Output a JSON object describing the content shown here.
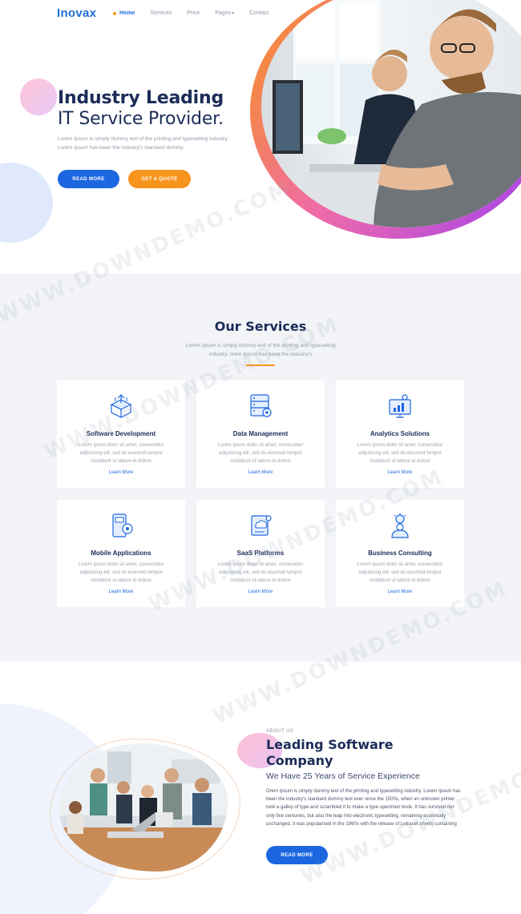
{
  "nav": {
    "logo": "Inovax",
    "items": [
      {
        "label": "Home",
        "active": true
      },
      {
        "label": "Services",
        "active": false
      },
      {
        "label": "Price",
        "active": false
      },
      {
        "label": "Pages",
        "active": false,
        "dropdown": true
      },
      {
        "label": "Contact",
        "active": false
      }
    ]
  },
  "hero": {
    "title_line1": "Industry Leading",
    "title_line2": "IT Service Provider.",
    "description_line1": "Lorem Ipsum is simply dummy text of the printing and typesetting industry.",
    "description_line2": "Lorem Ipsum has been the industry's standard dummy.",
    "btn_read_more": "READ MORE",
    "btn_quote": "GET A QUOTE"
  },
  "services": {
    "title": "Our Services",
    "description_line1": "Lorem Ipsum is simply dummy text of the printing and typesetting",
    "description_line2": "industry. orem Ipsum has been the industry's",
    "cards": [
      {
        "title": "Software Development",
        "icon": "box-upload-icon",
        "desc": "Lorem ipsum dolor sit amet, consectetur adipisicing elit, sed do eiusmod tempor incididunt ut labore et dolore",
        "link": "Learn More"
      },
      {
        "title": "Data Management",
        "icon": "server-gear-icon",
        "desc": "Lorem ipsum dolor sit amet, consectetur adipisicing elit, sed do eiusmod tempor incididunt ut labore et dolore",
        "link": "Learn More"
      },
      {
        "title": "Analytics Solutions",
        "icon": "chart-monitor-icon",
        "desc": "Lorem ipsum dolor sit amet, consectetur adipisicing elit, sed do eiusmod tempor incididunt ut labore et dolore",
        "link": "Learn More"
      },
      {
        "title": "Mobile Applications",
        "icon": "mobile-gear-icon",
        "desc": "Lorem ipsum dolor sit amet, consectetur adipisicing elit, sed do eiusmod tempor incididunt ut labore et dolore",
        "link": "Learn More"
      },
      {
        "title": "SaaS Platforms",
        "icon": "cloud-document-icon",
        "desc": "Lorem ipsum dolor sit amet, consectetur adipisicing elit, sed do eiusmod tempor incididunt ut labore et dolore",
        "link": "Learn More"
      },
      {
        "title": "Business Consulting",
        "icon": "consultant-idea-icon",
        "desc": "Lorem ipsum dolor sit amet, consectetur adipisicing elit, sed do eiusmod tempor incididunt ut labore et dolore",
        "link": "Learn More"
      }
    ]
  },
  "about": {
    "tag": "ABOUT US",
    "title": "Leading Software Company",
    "subtitle": "We Have 25 Years of Service Experience",
    "description": "Orem Ipsum is simply dummy text of the printing and typesetting industry. Lorem Ipsum has been the industry's standard dummy text ever since the 1500s, when an unknown printer took a galley of type and scrambled it to make a type specimen book. It has survived not only five centuries, but also the leap into electronic typesetting, remaining essentially unchanged. It was popularised in the 1960s with the release of Letraset sheets containing",
    "btn_read_more": "READ MORE"
  },
  "watermark": "WWW.DOWNDEMO.COM",
  "colors": {
    "primary": "#1c66e0",
    "accent": "#f7941d",
    "heading": "#1b2c57"
  }
}
